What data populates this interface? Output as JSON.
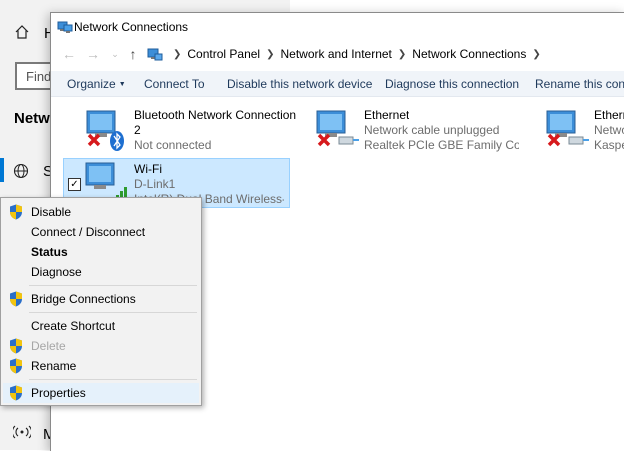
{
  "settings_bg": {
    "home_label": "H",
    "search_placeholder": "Find",
    "section_title": "Netwo",
    "status_item": "S",
    "mobile_item": "M"
  },
  "window": {
    "title": "Network Connections",
    "breadcrumb": [
      "Control Panel",
      "Network and Internet",
      "Network Connections"
    ]
  },
  "toolbar": {
    "organize": "Organize",
    "connect_to": "Connect To",
    "disable_device": "Disable this network device",
    "diagnose": "Diagnose this connection",
    "rename": "Rename this connec"
  },
  "connections": [
    {
      "name": "Bluetooth Network Connection",
      "name2": "2",
      "status": "Not connected",
      "device": ""
    },
    {
      "name": "Ethernet",
      "status": "Network cable unplugged",
      "device": "Realtek PCIe GBE Family Cont..."
    },
    {
      "name": "Ethern",
      "status": "Netwo",
      "device": "Kaspe"
    },
    {
      "name": "Wi-Fi",
      "status": "D-Link1",
      "device": "Intel(R) Dual Band Wireless-A..."
    }
  ],
  "context_menu": {
    "disable": "Disable",
    "connect_disconnect": "Connect / Disconnect",
    "status": "Status",
    "diagnose": "Diagnose",
    "bridge": "Bridge Connections",
    "create_shortcut": "Create Shortcut",
    "delete": "Delete",
    "rename": "Rename",
    "properties": "Properties"
  },
  "colors": {
    "accent": "#0078d4",
    "selection_bg": "#cce8ff",
    "toolbar_text": "#1e395b"
  }
}
